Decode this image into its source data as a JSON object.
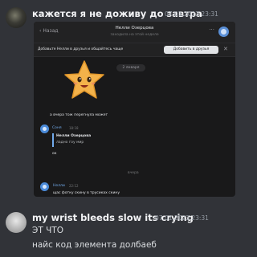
{
  "messages": [
    {
      "text": "кажется я не доживу до завтра",
      "timestamp": "07.01.2023 23:31",
      "screenshot": {
        "back_label": "Назад",
        "title": "Нелли Озерцова",
        "subtitle": "заходила на этой неделе",
        "friend_prompt": "Добавьте Нелли в друзья и общайтесь чаще",
        "add_friend_label": "Добавить в друзья",
        "date_label": "2 января",
        "chat": [
          {
            "text": "а вчера тож перегнула может"
          },
          {
            "author": "Соня",
            "time": "18:18",
            "quote_author": "Нелли Озерцова",
            "quote_text": "ладно гоу мир",
            "text": "ок"
          },
          {
            "text": "вчера"
          },
          {
            "author": "Нелли",
            "time": "22:12",
            "text": "щас фотку скину в трусиках скину"
          }
        ]
      }
    },
    {
      "author": "my wrist bleeds slow its crying",
      "timestamp": "07.01.2023 23:31",
      "lines": [
        "ЭТ ЧТО",
        "найс код элемента долбаеб"
      ]
    }
  ],
  "colors": {
    "background": "#313338",
    "username": "#f2f3f5",
    "timestamp": "#949ba4",
    "vk_accent": "#71aaeb"
  },
  "icons": [
    "avatar",
    "star-sticker",
    "close-icon",
    "more-icon"
  ]
}
